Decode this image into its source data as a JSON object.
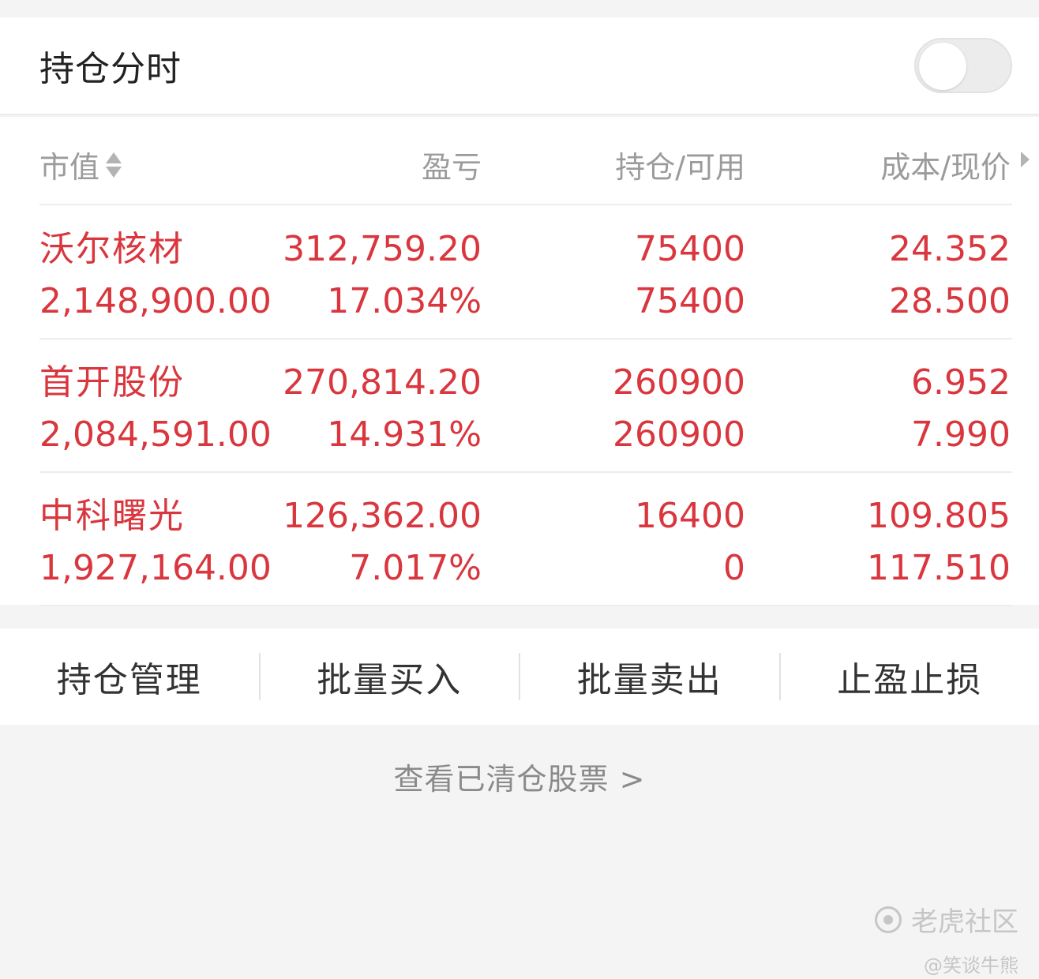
{
  "header": {
    "title": "持仓分时",
    "toggle_state": "off"
  },
  "table": {
    "columns": {
      "market_value": "市值",
      "profit_loss": "盈亏",
      "position": "持仓/可用",
      "cost": "成本/现价"
    },
    "rows": [
      {
        "name": "沃尔核材",
        "market_value": "2,148,900.00",
        "pl_amount": "312,759.20",
        "pl_percent": "17.034%",
        "position": "75400",
        "available": "75400",
        "cost": "24.352",
        "price": "28.500"
      },
      {
        "name": "首开股份",
        "market_value": "2,084,591.00",
        "pl_amount": "270,814.20",
        "pl_percent": "14.931%",
        "position": "260900",
        "available": "260900",
        "cost": "6.952",
        "price": "7.990"
      },
      {
        "name": "中科曙光",
        "market_value": "1,927,164.00",
        "pl_amount": "126,362.00",
        "pl_percent": "7.017%",
        "position": "16400",
        "available": "0",
        "cost": "109.805",
        "price": "117.510"
      }
    ]
  },
  "actions": {
    "manage": "持仓管理",
    "batch_buy": "批量买入",
    "batch_sell": "批量卖出",
    "stop": "止盈止损"
  },
  "cleared_link": "查看已清仓股票 >",
  "watermark": {
    "brand": "老虎社区",
    "user": "@笑谈牛熊"
  },
  "colors": {
    "gain": "#d9363e",
    "muted": "#9b9b9b",
    "background": "#f4f4f4"
  }
}
